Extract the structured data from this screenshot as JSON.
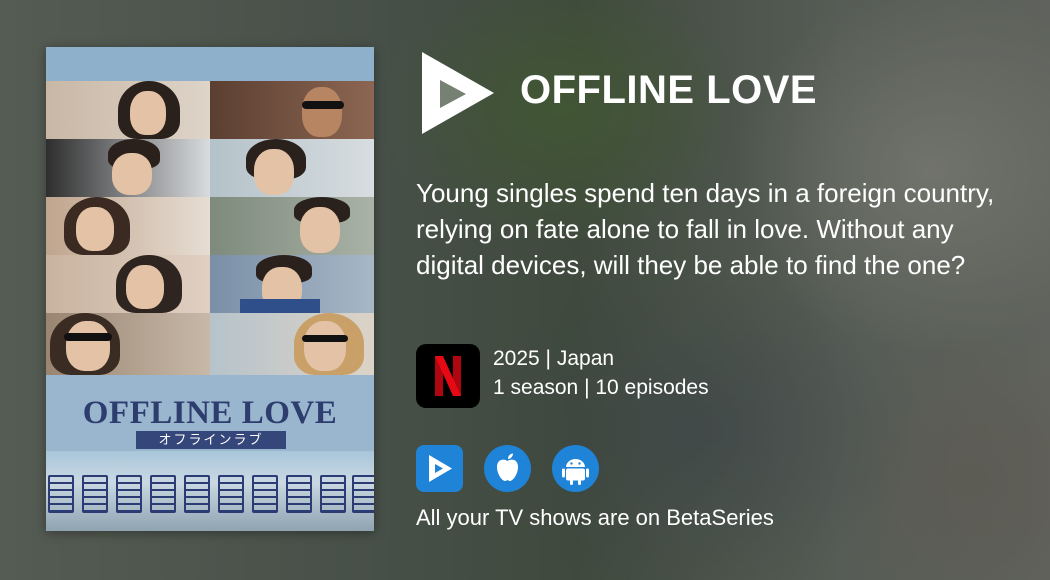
{
  "show": {
    "title": "OFFLINE LOVE",
    "description": "Young singles spend ten days in a foreign country, relying on fate alone to fall in love. Without any digital devices, will they be able to find the one?",
    "meta_line1": "2025 | Japan",
    "meta_line2": "1 season | 10 episodes",
    "network_icon": "netflix-icon"
  },
  "poster": {
    "title": "OFFLINE LOVE",
    "subtitle": "オフラインラブ"
  },
  "apps": [
    {
      "icon": "betaseries-icon",
      "label": "BetaSeries"
    },
    {
      "icon": "apple-icon",
      "label": "iOS"
    },
    {
      "icon": "android-icon",
      "label": "Android"
    }
  ],
  "footer": {
    "tagline": "All your TV shows are on BetaSeries"
  },
  "colors": {
    "accent": "#1f83d8",
    "netflix_red": "#e50914",
    "poster_title": "#2d3d6e"
  }
}
